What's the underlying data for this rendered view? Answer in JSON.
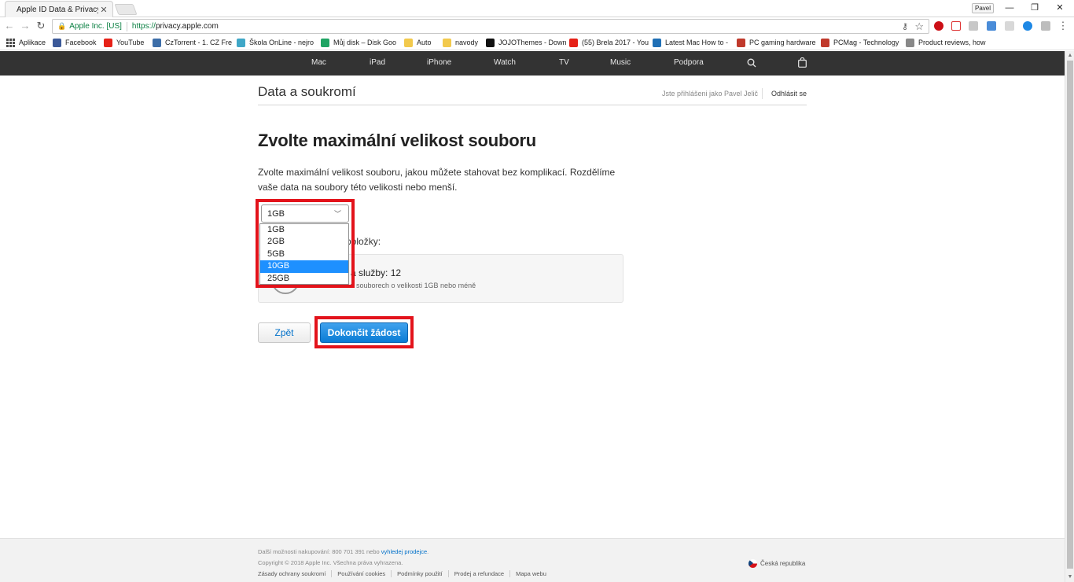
{
  "browser": {
    "tab_title": "Apple ID Data & Privacy",
    "tab_favicon": "apple-icon",
    "user_name": "Pavel",
    "omnibox": {
      "org": "Apple Inc. [US]",
      "scheme": "https://",
      "host": "privacy.apple.com"
    },
    "bookmarks": [
      {
        "label": "Aplikace",
        "icon": "apps-grid-icon",
        "color": "#4a4a4a"
      },
      {
        "label": "Facebook",
        "icon": "facebook-icon",
        "color": "#3b5998"
      },
      {
        "label": "YouTube",
        "icon": "youtube-icon",
        "color": "#e62117"
      },
      {
        "label": "CzTorrent - 1. CZ Fre",
        "icon": "cztorrent-icon",
        "color": "#3d6ea8"
      },
      {
        "label": "Škola OnLine - nejro",
        "icon": "skola-online-icon",
        "color": "#3fa7c7"
      },
      {
        "label": "Můj disk – Disk Goo",
        "icon": "google-drive-icon",
        "color": "#1fa463"
      },
      {
        "label": "Auto",
        "icon": "folder-icon",
        "color": "#f2c94c"
      },
      {
        "label": "navody",
        "icon": "folder-icon",
        "color": "#f2c94c"
      },
      {
        "label": "JOJOThemes - Down",
        "icon": "jojo-icon",
        "color": "#111111"
      },
      {
        "label": "(55) Brela 2017 - You",
        "icon": "youtube-icon",
        "color": "#e62117"
      },
      {
        "label": "Latest Mac How to -",
        "icon": "m-icon",
        "color": "#1f6fb5"
      },
      {
        "label": "PC gaming hardware",
        "icon": "pc-icon",
        "color": "#c0392b"
      },
      {
        "label": "PCMag - Technology",
        "icon": "pc-icon",
        "color": "#c0392b"
      },
      {
        "label": "Product reviews, how",
        "icon": "page-icon",
        "color": "#888888"
      }
    ]
  },
  "gnav": {
    "logo": "apple-logo-icon",
    "items": [
      "Mac",
      "iPad",
      "iPhone",
      "Watch",
      "TV",
      "Music",
      "Podpora"
    ],
    "search_icon": "search-icon",
    "bag_icon": "bag-icon"
  },
  "localnav": {
    "title": "Data a soukromí",
    "signed_in": "Jste přihlášeni jako Pavel Jelič",
    "logout": "Odhlásit se"
  },
  "main": {
    "heading": "Zvolte maximální velikost souboru",
    "description": "Zvolte maximální velikost souboru, jakou můžete stahovat bez komplikací. Rozdělíme vaše data na soubory této velikosti nebo menší.",
    "select": {
      "value": "1GB",
      "options": [
        "1GB",
        "2GB",
        "5GB",
        "10GB",
        "25GB"
      ],
      "highlighted_index": 3
    },
    "items_label": "položky:",
    "summary": {
      "title": "a služby: 12",
      "subtitle": "v souborech o velikosti 1GB nebo méně"
    },
    "back_label": "Zpět",
    "finish_label": "Dokončit žádost",
    "highlight_color": "#e3131b",
    "accent_color": "#0070c9"
  },
  "footer": {
    "shop_text": "Další možnosti nakupování: 800 701 391 nebo",
    "shop_link": "vyhledej prodejce",
    "shop_end": ".",
    "copyright": "Copyright © 2018 Apple Inc. Všechna práva vyhrazena.",
    "links": [
      "Zásady ochrany soukromí",
      "Používání cookies",
      "Podmínky použití",
      "Prodej a refundace",
      "Mapa webu"
    ],
    "region": "Česká republika"
  }
}
